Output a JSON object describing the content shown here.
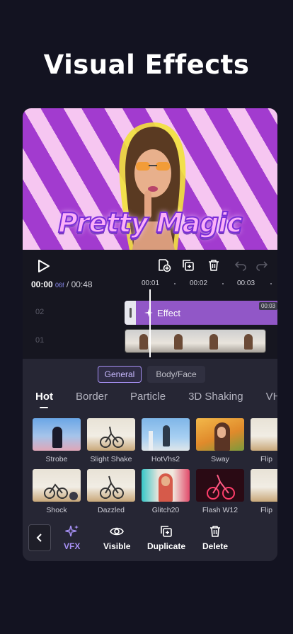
{
  "headline": "Visual Effects",
  "preview": {
    "caption": "Pretty Magic"
  },
  "timeline": {
    "current_time": "00:00",
    "current_frame": "06f",
    "total_time": "/ 00:48",
    "ruler": [
      "00:01",
      "00:02",
      "00:03"
    ],
    "track_labels": [
      "02",
      "01"
    ],
    "effect_label": "Effect",
    "effect_time": "00:03"
  },
  "tabs": {
    "general": "General",
    "body_face": "Body/Face"
  },
  "categories": [
    "Hot",
    "Border",
    "Particle",
    "3D Shaking",
    "VHS"
  ],
  "effects": [
    {
      "label": "Strobe",
      "icon": "strobe-thumb"
    },
    {
      "label": "Slight Shake",
      "icon": "slight-shake-thumb"
    },
    {
      "label": "HotVhs2",
      "icon": "hotvhs2-thumb"
    },
    {
      "label": "Sway",
      "icon": "sway-thumb"
    },
    {
      "label": "Flip",
      "icon": "flip-thumb"
    },
    {
      "label": "Shock",
      "icon": "shock-thumb"
    },
    {
      "label": "Dazzled",
      "icon": "dazzled-thumb"
    },
    {
      "label": "Glitch20",
      "icon": "glitch20-thumb"
    },
    {
      "label": "Flash W12",
      "icon": "flash-w12-thumb"
    },
    {
      "label": "Flip",
      "icon": "flip-thumb"
    }
  ],
  "toolbar": {
    "vfx": "VFX",
    "visible": "Visible",
    "duplicate": "Duplicate",
    "delete": "Delete"
  },
  "colors": {
    "accent": "#9157c7",
    "accent_text": "#a690f4",
    "background": "#131321"
  }
}
